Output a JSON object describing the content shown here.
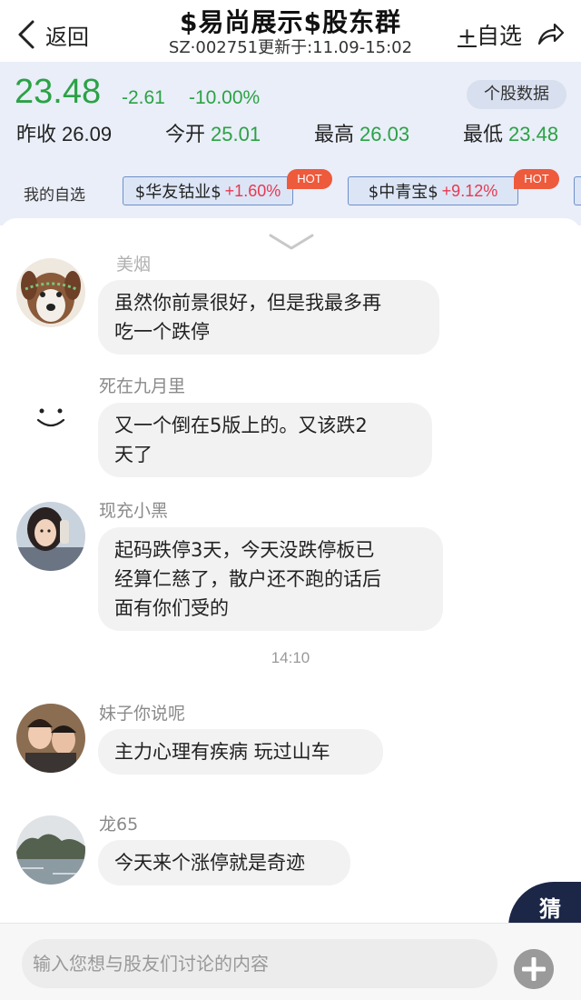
{
  "header": {
    "back_label": "返回",
    "title": "$易尚展示$股东群",
    "subtitle": "SZ·002751更新于:11.09-15:02",
    "add_watch_plus": "+",
    "add_watch_label": "自选"
  },
  "quote": {
    "price": "23.48",
    "change": "-2.61",
    "change_pct": "-10.00%",
    "stock_data_button": "个股数据",
    "prev_close_label": "昨收",
    "prev_close": "26.09",
    "open_label": "今开",
    "open": "25.01",
    "high_label": "最高",
    "high": "26.03",
    "low_label": "最低",
    "low": "23.48",
    "color_down": "#2ba245",
    "color_up": "#e8384f"
  },
  "watchlist": {
    "label": "我的自选",
    "items": [
      {
        "name": "$华友钴业$",
        "pct": "+1.60%",
        "badge": "HOT"
      },
      {
        "name": "$中青宝$",
        "pct": "+9.12%",
        "badge": "HOT"
      }
    ]
  },
  "chat": {
    "messages": [
      {
        "user": "美烟",
        "text_lines": [
          "虽然你前景很好，但是我最多再",
          "吃一个跌停"
        ],
        "avatar": "dog-avatar"
      },
      {
        "user": "死在九月里",
        "text_lines": [
          "又一个倒在5版上的。又该跌2",
          "天了"
        ],
        "avatar": "smiley-avatar"
      },
      {
        "user": "现充小黑",
        "text_lines": [
          " 起码跌停3天，今天没跌停板已",
          "经算仁慈了，散户还不跑的话后",
          "面有你们受的"
        ],
        "avatar": "girl-avatar"
      },
      {
        "user": "妹子你说呢",
        "text_lines": [
          " 主力心理有疾病 玩过山车"
        ],
        "avatar": "couple-avatar"
      },
      {
        "user": "龙65",
        "text_lines": [
          "今天来个涨停就是奇迹"
        ],
        "avatar": "lake-avatar"
      }
    ],
    "time_divider": "14:10",
    "guess_label": "猜"
  },
  "input": {
    "placeholder": "输入您想与股友们讨论的内容"
  }
}
